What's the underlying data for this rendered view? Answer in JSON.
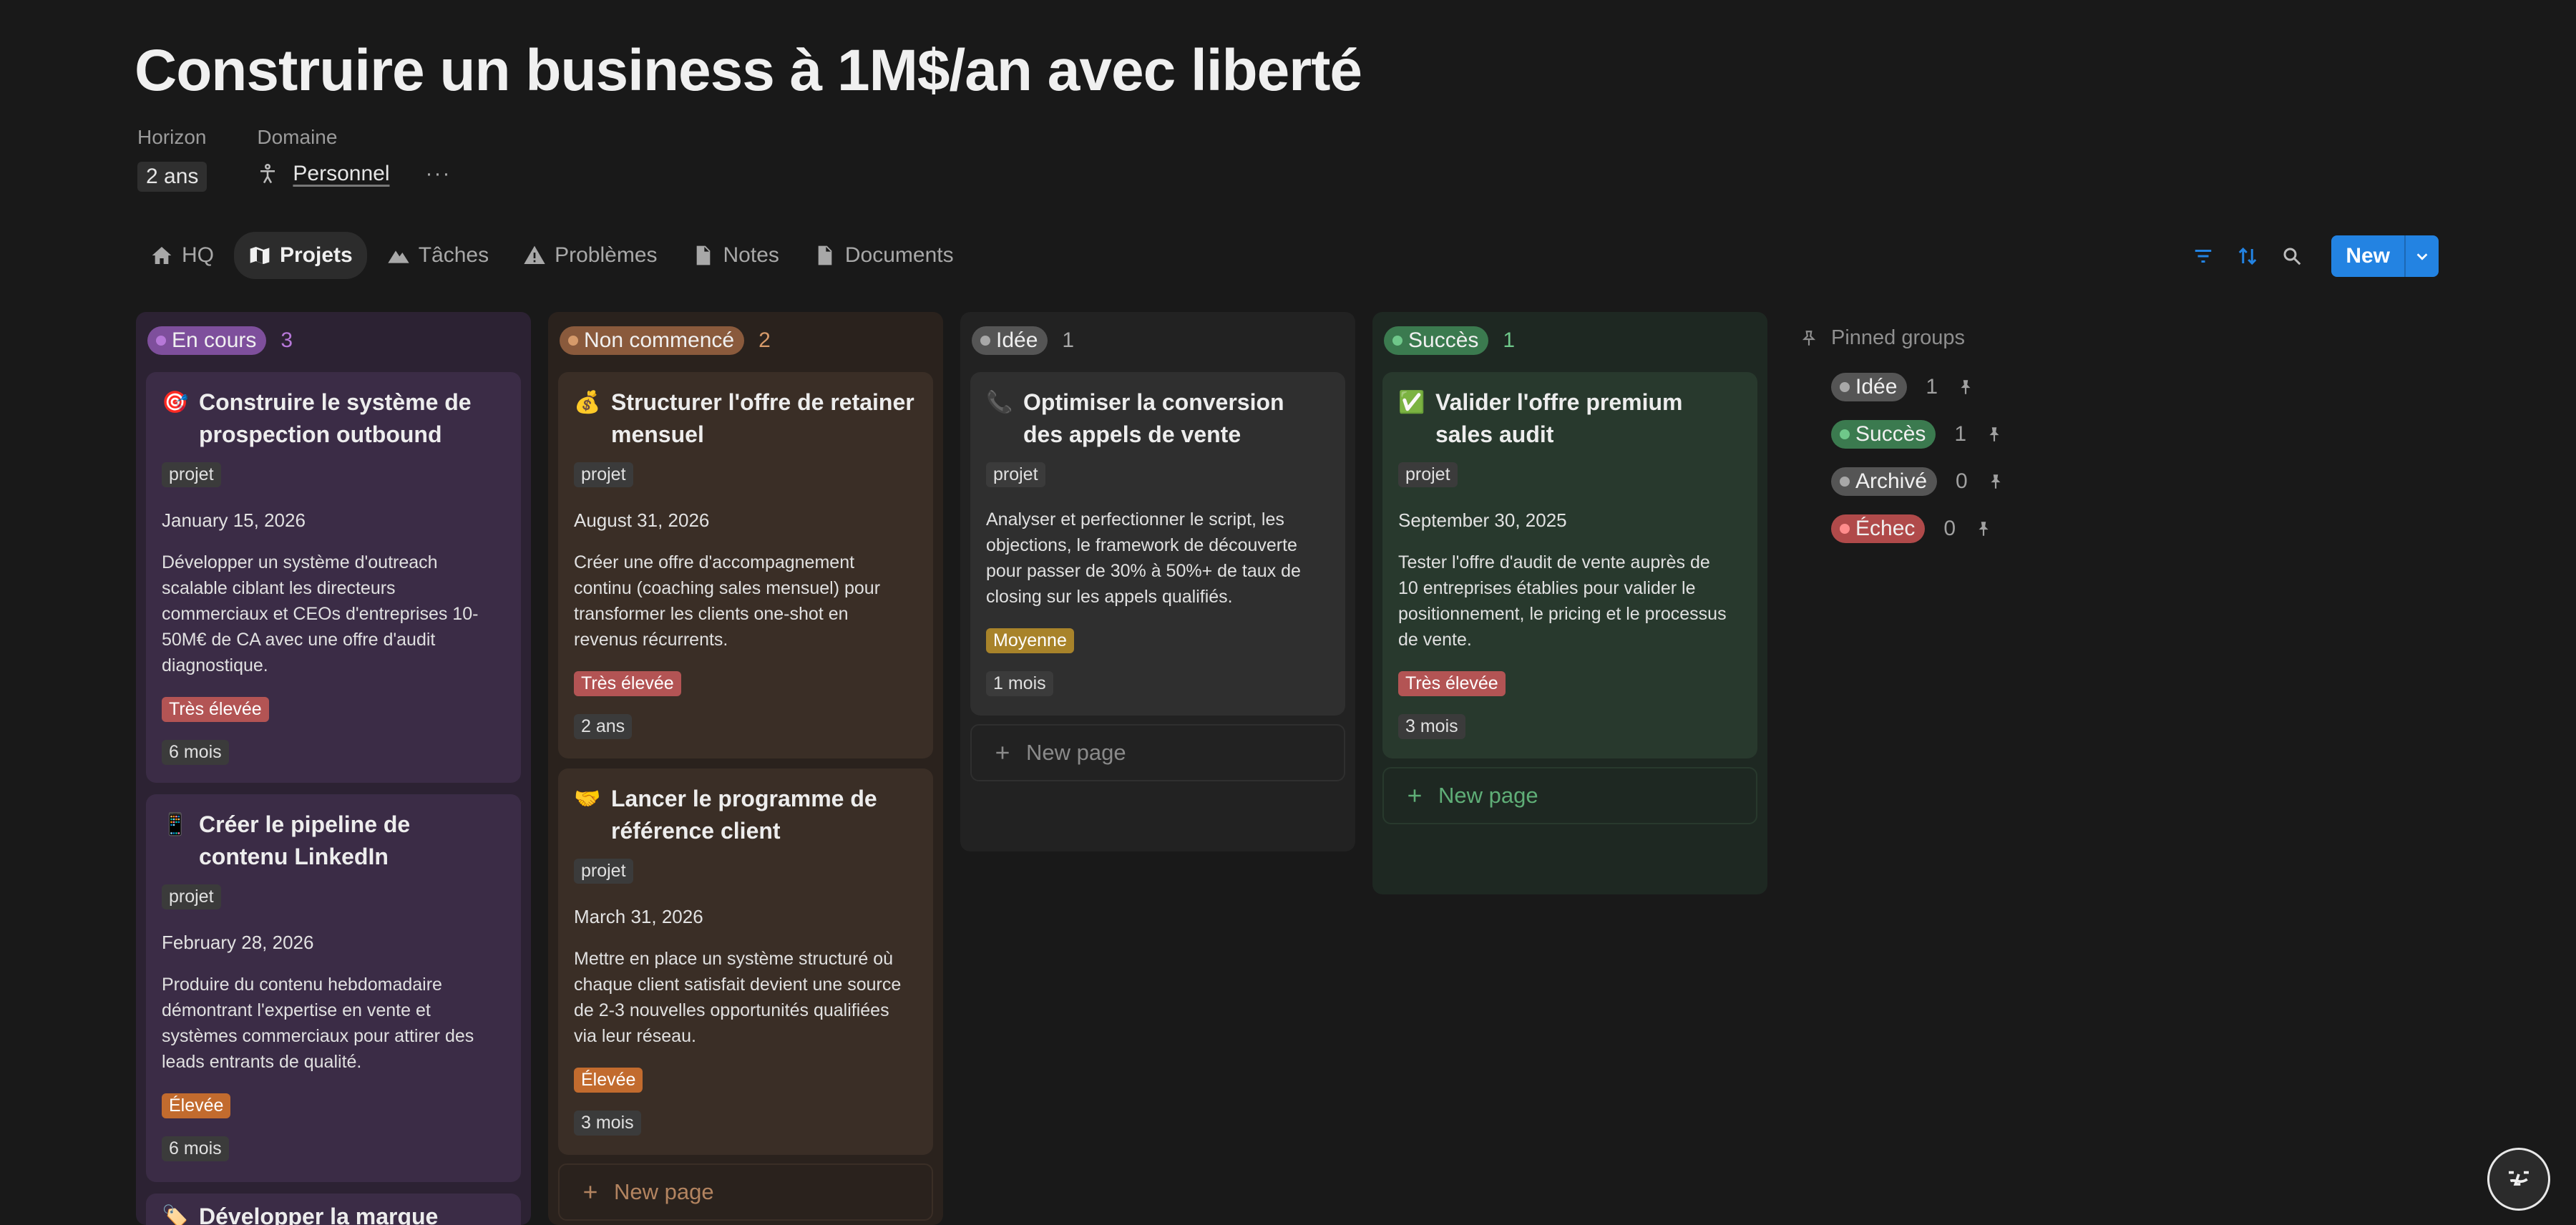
{
  "page": {
    "title": "Construire un business à 1M$/an avec liberté",
    "props": {
      "horizon_label": "Horizon",
      "horizon_value": "2 ans",
      "domain_label": "Domaine",
      "domain_value": "Personnel",
      "more": "···"
    }
  },
  "tabs": [
    {
      "label": "HQ",
      "icon": "home-icon"
    },
    {
      "label": "Projets",
      "icon": "map-icon",
      "active": true
    },
    {
      "label": "Tâches",
      "icon": "mountain-icon"
    },
    {
      "label": "Problèmes",
      "icon": "warning-icon"
    },
    {
      "label": "Notes",
      "icon": "document-icon"
    },
    {
      "label": "Documents",
      "icon": "document-icon"
    }
  ],
  "toolbar": {
    "new_label": "New",
    "icons": [
      "filter-icon",
      "sort-icon",
      "search-icon",
      "chevron-down-icon"
    ],
    "accent": "#2383e2"
  },
  "columns": [
    {
      "name": "En cours",
      "count": "3",
      "colors": {
        "bg": "#2c2233",
        "card": "#3b2c46",
        "tag": "#7e4f9c",
        "dot": "#b678d8",
        "count": "#b678d8"
      },
      "cards": [
        {
          "emoji": "🎯",
          "title": "Construire le système de prospection outbound",
          "type": "projet",
          "date": "January 15, 2026",
          "desc": "Développer un système d'outreach scalable ciblant les directeurs commerciaux et CEOs d'entreprises 10-50M€ de CA avec une offre d'audit diagnostique.",
          "priority": "Très élevée",
          "priority_color": "red",
          "duration": "6 mois"
        },
        {
          "emoji": "📱",
          "title": "Créer le pipeline de contenu LinkedIn",
          "type": "projet",
          "date": "February 28, 2026",
          "desc": "Produire du contenu hebdomadaire démontrant l'expertise en vente et systèmes commerciaux pour attirer des leads entrants de qualité.",
          "priority": "Élevée",
          "priority_color": "orange",
          "duration": "6 mois"
        },
        {
          "emoji": "🏷️",
          "title": "Développer la marque"
        }
      ]
    },
    {
      "name": "Non commencé",
      "count": "2",
      "colors": {
        "bg": "#2a221d",
        "card": "#3a2e26",
        "tag": "#8a5a3c",
        "dot": "#d69a6a",
        "count": "#d69a6a"
      },
      "cards": [
        {
          "emoji": "💰",
          "title": "Structurer l'offre de retainer mensuel",
          "type": "projet",
          "date": "August 31, 2026",
          "desc": "Créer une offre d'accompagnement continu (coaching sales mensuel) pour transformer les clients one-shot en revenus récurrents.",
          "priority": "Très élevée",
          "priority_color": "red",
          "duration": "2 ans"
        },
        {
          "emoji": "🤝",
          "title": "Lancer le programme de référence client",
          "type": "projet",
          "date": "March 31, 2026",
          "desc": "Mettre en place un système structuré où chaque client satisfait devient une source de 2-3 nouvelles opportunités qualifiées via leur réseau.",
          "priority": "Élevée",
          "priority_color": "orange",
          "duration": "3 mois"
        }
      ],
      "new_page": "New page"
    },
    {
      "name": "Idée",
      "count": "1",
      "colors": {
        "bg": "#222222",
        "card": "#2f2f2f",
        "tag": "#555555",
        "dot": "#a8a8a8",
        "count": "#a8a8a8"
      },
      "cards": [
        {
          "emoji": "📞",
          "title": "Optimiser la conversion des appels de vente",
          "type": "projet",
          "desc": "Analyser et perfectionner le script, les objections, le framework de découverte pour passer de 30% à 50%+ de taux de closing sur les appels qualifiés.",
          "priority": "Moyenne",
          "priority_color": "yellow",
          "duration": "1 mois"
        }
      ],
      "new_page": "New page"
    },
    {
      "name": "Succès",
      "count": "1",
      "colors": {
        "bg": "#1e2822",
        "card": "#28392d",
        "tag": "#3b7a4f",
        "dot": "#6fc88a",
        "count": "#6fc88a"
      },
      "cards": [
        {
          "emoji": "✅",
          "title": "Valider l'offre premium sales audit",
          "type": "projet",
          "date": "September 30, 2025",
          "desc": "Tester l'offre d'audit de vente auprès de 10 entreprises établies pour valider le positionnement, le pricing et le processus de vente.",
          "priority": "Très élevée",
          "priority_color": "red",
          "duration": "3 mois"
        }
      ],
      "new_page": "New page"
    }
  ],
  "pinned": {
    "label": "Pinned groups",
    "groups": [
      {
        "name": "Idée",
        "count": "1",
        "tag": "#555555",
        "dot": "#a8a8a8"
      },
      {
        "name": "Succès",
        "count": "1",
        "tag": "#3b7a4f",
        "dot": "#6fc88a"
      },
      {
        "name": "Archivé",
        "count": "0",
        "tag": "#555555",
        "dot": "#a8a8a8"
      },
      {
        "name": "Échec",
        "count": "0",
        "tag": "#b04a4a",
        "dot": "#ff8c8c"
      }
    ]
  }
}
